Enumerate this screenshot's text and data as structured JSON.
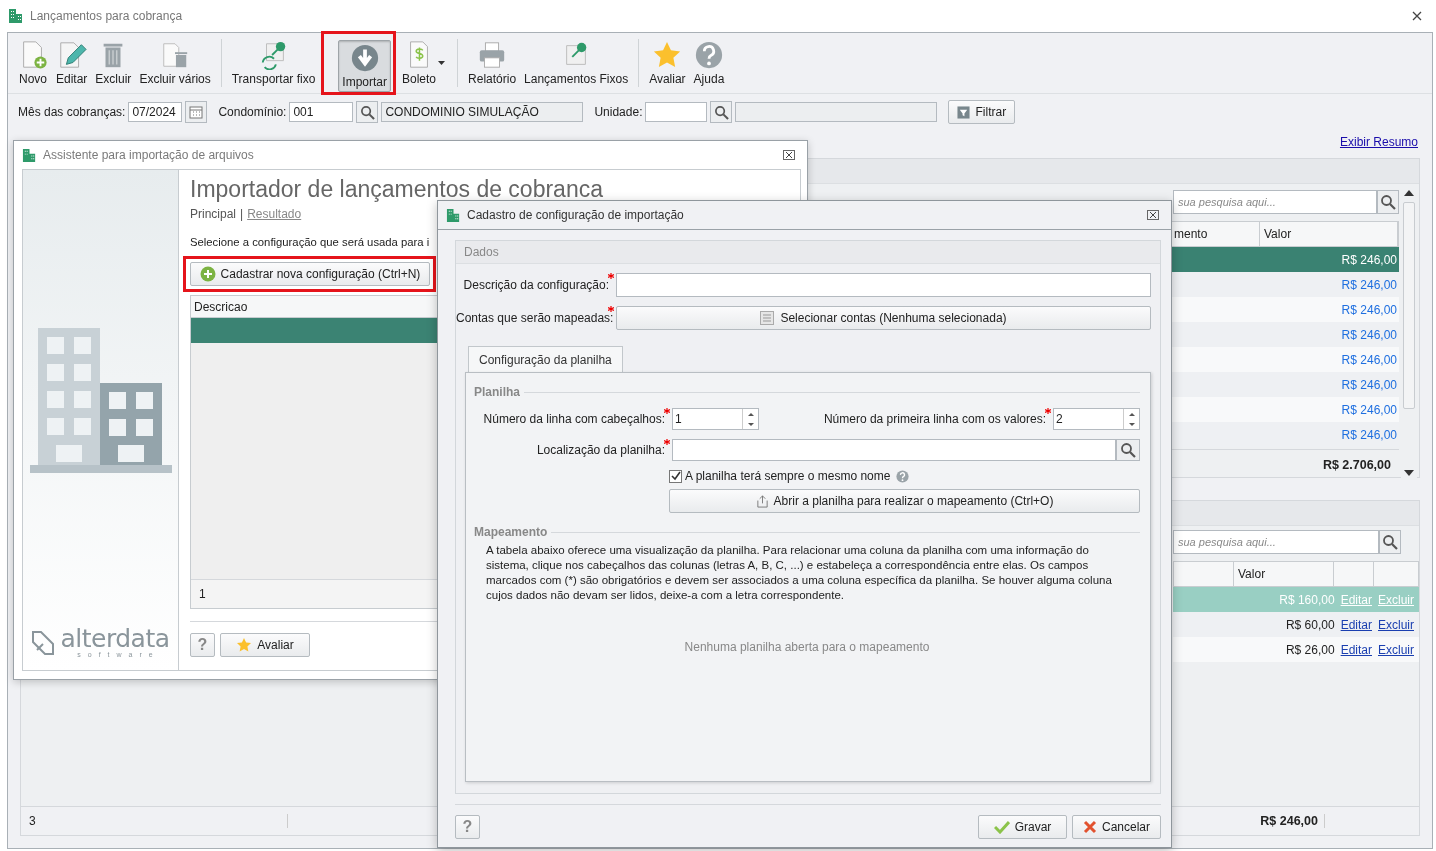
{
  "window": {
    "title": "Lançamentos para cobrança"
  },
  "toolbar": {
    "groups": [
      [
        {
          "label": "Novo",
          "kind": "new",
          "pressed": false,
          "highlighted": false,
          "dropdown": false
        },
        {
          "label": "Editar",
          "kind": "edit",
          "pressed": false,
          "highlighted": false,
          "dropdown": false
        },
        {
          "label": "Excluir",
          "kind": "delete",
          "pressed": false,
          "highlighted": false,
          "dropdown": false
        },
        {
          "label": "Excluir vários",
          "kind": "delete-many",
          "pressed": false,
          "highlighted": false,
          "dropdown": false
        }
      ],
      [
        {
          "label": "Transportar fixo",
          "kind": "transport",
          "pressed": false,
          "highlighted": false,
          "dropdown": false
        },
        {
          "label": "Importar",
          "kind": "import",
          "pressed": true,
          "highlighted": true,
          "dropdown": false
        },
        {
          "label": "Boleto",
          "kind": "boleto",
          "pressed": false,
          "highlighted": false,
          "dropdown": true
        }
      ],
      [
        {
          "label": "Relatório",
          "kind": "report",
          "pressed": false,
          "highlighted": false,
          "dropdown": false
        },
        {
          "label": "Lançamentos Fixos",
          "kind": "fixed",
          "pressed": false,
          "highlighted": false,
          "dropdown": false
        }
      ],
      [
        {
          "label": "Avaliar",
          "kind": "rate",
          "pressed": false,
          "highlighted": false,
          "dropdown": false
        },
        {
          "label": "Ajuda",
          "kind": "help",
          "pressed": false,
          "highlighted": false,
          "dropdown": false
        }
      ]
    ]
  },
  "filters": {
    "month": {
      "label": "Mês das cobranças:",
      "value": "07/2024"
    },
    "condo": {
      "label": "Condomínio:",
      "value": "001",
      "name": "CONDOMINIO SIMULAÇÃO"
    },
    "unit": {
      "label": "Unidade:"
    },
    "filter_button": "Filtrar"
  },
  "summary_link": "Exibir Resumo",
  "upper_grid": {
    "search": {
      "placeholder": "sua pesquisa aqui..."
    },
    "columns": [
      "mento",
      "Valor"
    ],
    "rows": [
      {
        "value": "R$ 246,00",
        "selected": true
      },
      {
        "value": "R$ 246,00",
        "selected": false
      },
      {
        "value": "R$ 246,00",
        "selected": false
      },
      {
        "value": "R$ 246,00",
        "selected": false
      },
      {
        "value": "R$ 246,00",
        "selected": false
      },
      {
        "value": "R$ 246,00",
        "selected": false
      },
      {
        "value": "R$ 246,00",
        "selected": false
      },
      {
        "value": "R$ 246,00",
        "selected": false
      }
    ],
    "total": "R$ 2.706,00"
  },
  "lower_grid": {
    "search": {
      "placeholder": "sua pesquisa aqui..."
    },
    "columns": [
      "Valor"
    ],
    "rows": [
      {
        "value": "R$ 160,00",
        "edit": "Editar",
        "delete": "Excluir",
        "selected": true
      },
      {
        "value": "R$ 60,00",
        "edit": "Editar",
        "delete": "Excluir",
        "selected": false
      },
      {
        "value": "R$ 26,00",
        "edit": "Editar",
        "delete": "Excluir",
        "selected": false
      }
    ],
    "count": "3",
    "total": "R$ 246,00"
  },
  "assistant": {
    "title": "Assistente para importação de arquivos",
    "logo": {
      "name": "alterdata",
      "tagline": "software"
    },
    "heading": "Importador de lançamentos de cobranca",
    "nav": [
      {
        "label": "Principal",
        "selected": true
      },
      {
        "label": "Resultado",
        "selected": false
      }
    ],
    "nav_separator": "|",
    "instruction": "Selecione a configuração que será usada para i",
    "new_button": {
      "label": "Cadastrar nova configuração (Ctrl+N)",
      "highlighted": true
    },
    "grid": {
      "columns": [
        "Descricao"
      ],
      "rows": [
        {
          "selected": true
        }
      ],
      "footer": "1"
    },
    "help_button": "?",
    "rate_button": "Avaliar"
  },
  "config": {
    "title": "Cadastro de configuração de importação",
    "group": "Dados",
    "description": {
      "label": "Descrição da configuração:",
      "required": true
    },
    "accounts": {
      "label": "Contas que serão mapeadas:",
      "required": true,
      "button": "Selecionar contas (Nenhuma selecionada)"
    },
    "tabs": [
      {
        "label": "Configuração da planilha",
        "selected": true
      }
    ],
    "sheet": {
      "heading": "Planilha",
      "header_row": {
        "label": "Número da linha com cabeçalhos:",
        "value": "1",
        "required": true
      },
      "first_row": {
        "label": "Número da primeira linha com os valores:",
        "value": "2",
        "required": true
      },
      "location": {
        "label": "Localização da planilha:",
        "required": true
      },
      "same_name": {
        "label": "A planilha terá sempre o mesmo nome",
        "checked": true
      },
      "open_button": "Abrir a planilha para realizar o mapeamento (Ctrl+O)"
    },
    "mapping": {
      "heading": "Mapeamento",
      "description": "A tabela abaixo oferece uma visualização da planilha. Para relacionar uma coluna da planilha com uma informação do sistema, clique nos cabeçalhos das colunas (letras A, B, C, ...) e estabeleça a correspondência entre elas. Os campos marcados com (*) são obrigatórios e devem ser associados a uma coluna específica da planilha. Se houver alguma coluna cujos dados não devam ser lidos, deixe-a com a letra correspondente.",
      "empty_message": "Nenhuma planilha aberta para o mapeamento"
    },
    "help_button": "?",
    "save_button": "Gravar",
    "cancel_button": "Cancelar"
  }
}
